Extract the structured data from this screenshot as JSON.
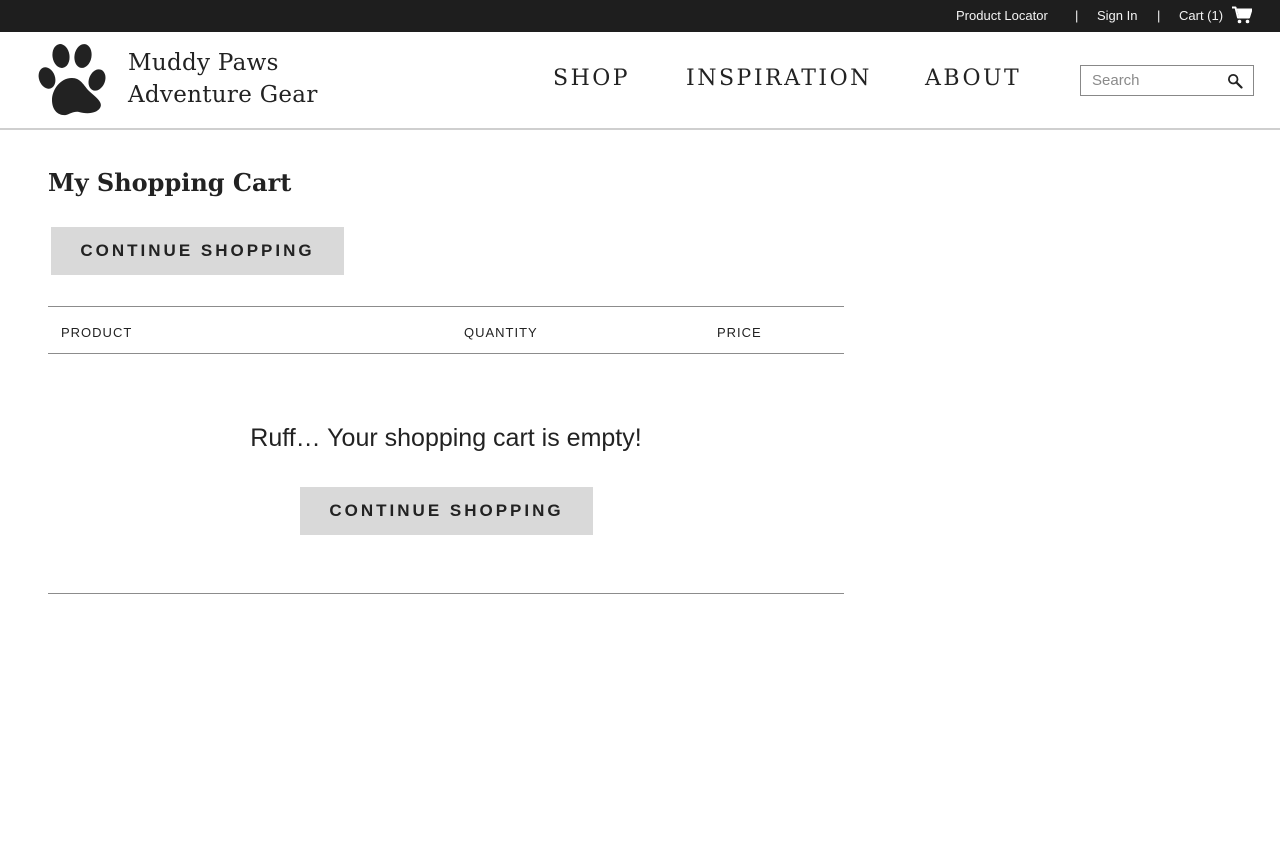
{
  "utility_bar": {
    "product_locator": "Product Locator",
    "separator": "|",
    "sign_in": "Sign In",
    "cart": "Cart (1)",
    "background": "#1e1e1e"
  },
  "header": {
    "brand_line1": "Muddy Paws",
    "brand_line2": "Adventure Gear",
    "nav": [
      "SHOP",
      "INSPIRATION",
      "ABOUT"
    ],
    "search_placeholder": "Search"
  },
  "main": {
    "title": "My Shopping Cart",
    "continue_shopping": "CONTINUE SHOPPING",
    "table_headers": [
      "PRODUCT",
      "QUANTITY",
      "PRICE"
    ],
    "empty_message": "Ruff… Your shopping cart is empty!",
    "button_color": "#d9d9d9"
  },
  "icons": {
    "cart": "cart-icon",
    "search": "search-icon",
    "logo": "paw-logo-icon"
  }
}
